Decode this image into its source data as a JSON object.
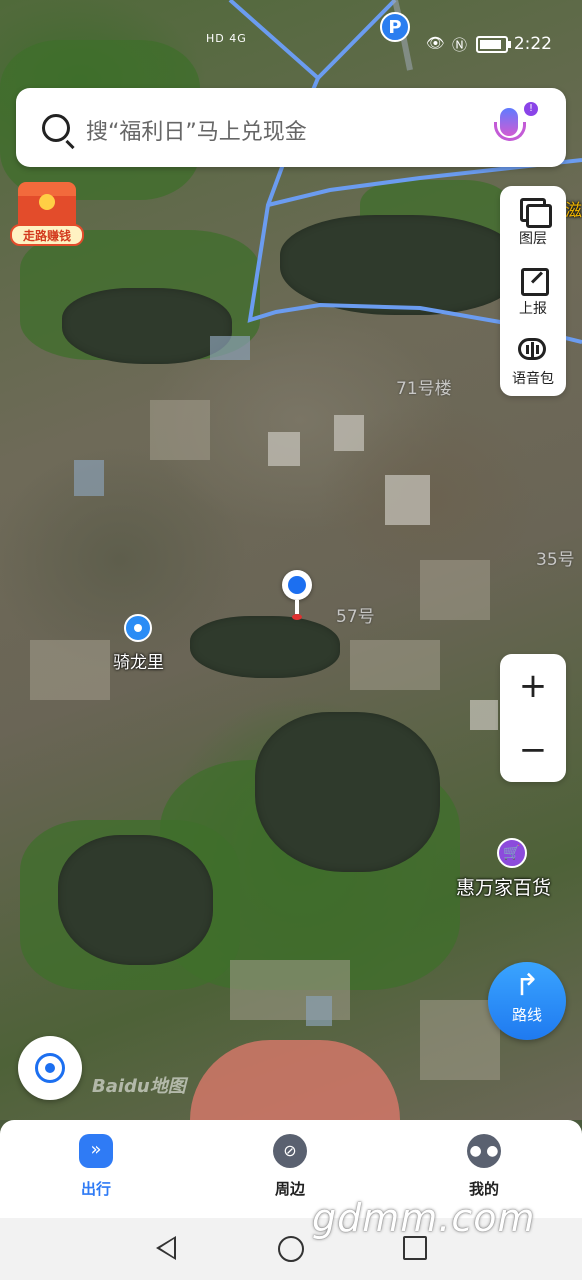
{
  "status_bar": {
    "network": "HD 4G",
    "time": "2:22",
    "battery_level": 0.8
  },
  "search": {
    "placeholder": "搜“福利日”马上兑现金",
    "mic_badge": "!"
  },
  "promo": {
    "label": "走路赚钱"
  },
  "tools": [
    {
      "label": "图层",
      "icon": "layers-icon"
    },
    {
      "label": "上报",
      "icon": "report-icon"
    },
    {
      "label": "语音包",
      "icon": "voice-pack-icon"
    }
  ],
  "map": {
    "labels": {
      "building_71": "71号楼",
      "building_35": "35号",
      "building_57": "57号",
      "poi_qilongli": "骑龙里",
      "poi_store": "惠万家百货",
      "edge_char": "滋",
      "watermark": "Baidu地图"
    },
    "parking_label": "P"
  },
  "zoom": {
    "in": "+",
    "out": "−"
  },
  "route": {
    "label": "路线"
  },
  "bottom_nav": [
    {
      "label": "出行",
      "active": true
    },
    {
      "label": "周边",
      "active": false
    },
    {
      "label": "我的",
      "active": false
    }
  ],
  "watermark_site": "gdmm.com",
  "colors": {
    "accent": "#2f7bf5",
    "route_line": "#6b9cf0"
  }
}
